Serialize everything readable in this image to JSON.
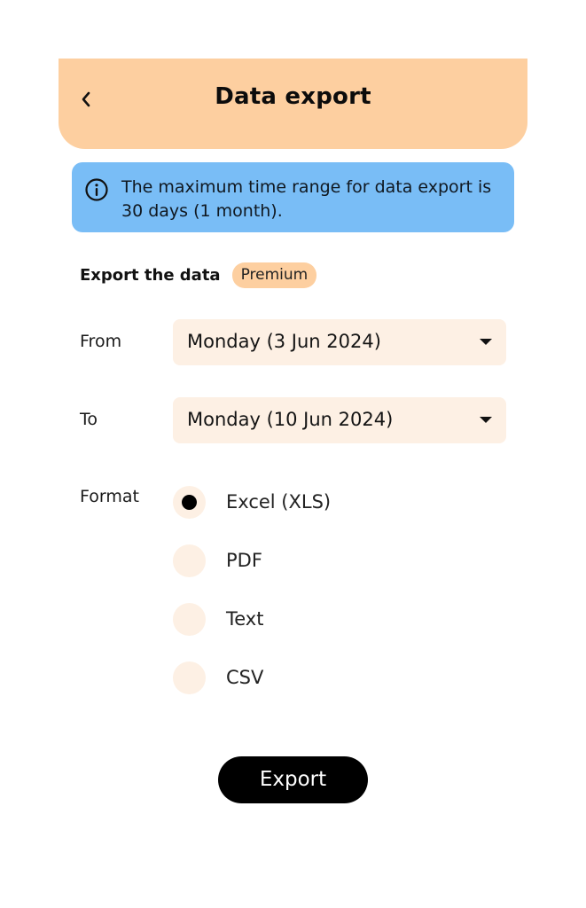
{
  "header": {
    "title": "Data export",
    "back_icon": "chevron-left-icon"
  },
  "info_banner": {
    "icon": "info-icon",
    "text": "The maximum time range for data export is 30 days (1 month)."
  },
  "section": {
    "title": "Export the data",
    "badge": "Premium"
  },
  "from": {
    "label": "From",
    "value": "Monday (3 Jun 2024)"
  },
  "to": {
    "label": "To",
    "value": "Monday (10 Jun 2024)"
  },
  "format": {
    "label": "Format",
    "options": [
      {
        "label": "Excel (XLS)",
        "selected": true
      },
      {
        "label": "PDF",
        "selected": false
      },
      {
        "label": "Text",
        "selected": false
      },
      {
        "label": "CSV",
        "selected": false
      }
    ]
  },
  "export_button": {
    "label": "Export"
  },
  "colors": {
    "header_bg": "#fdcfa0",
    "banner_bg": "#79bdf6",
    "field_bg": "#fdf0e4",
    "button_bg": "#000000"
  }
}
